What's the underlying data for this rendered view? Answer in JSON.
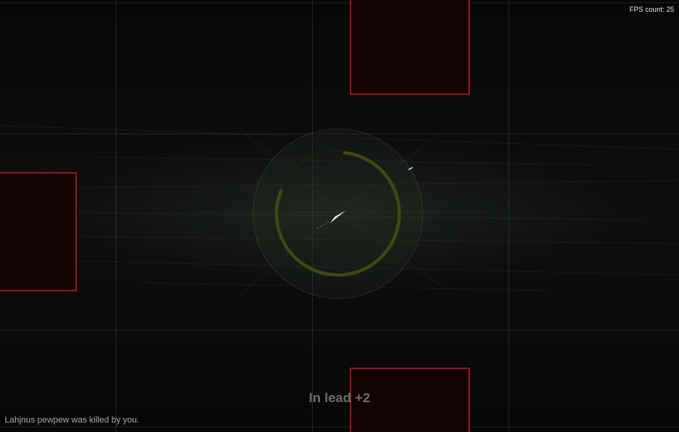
{
  "hud": {
    "fps_label": "FPS count: 25",
    "lead_text": "In lead +2",
    "kill_message": "Lahjnus pewpew was killed by you."
  },
  "colors": {
    "block_border": "#8c1722",
    "block_fill": "#140203",
    "ring": "#3f4a12",
    "player_ship": "#ffffff"
  },
  "player": {
    "shield_level": 0.8
  }
}
